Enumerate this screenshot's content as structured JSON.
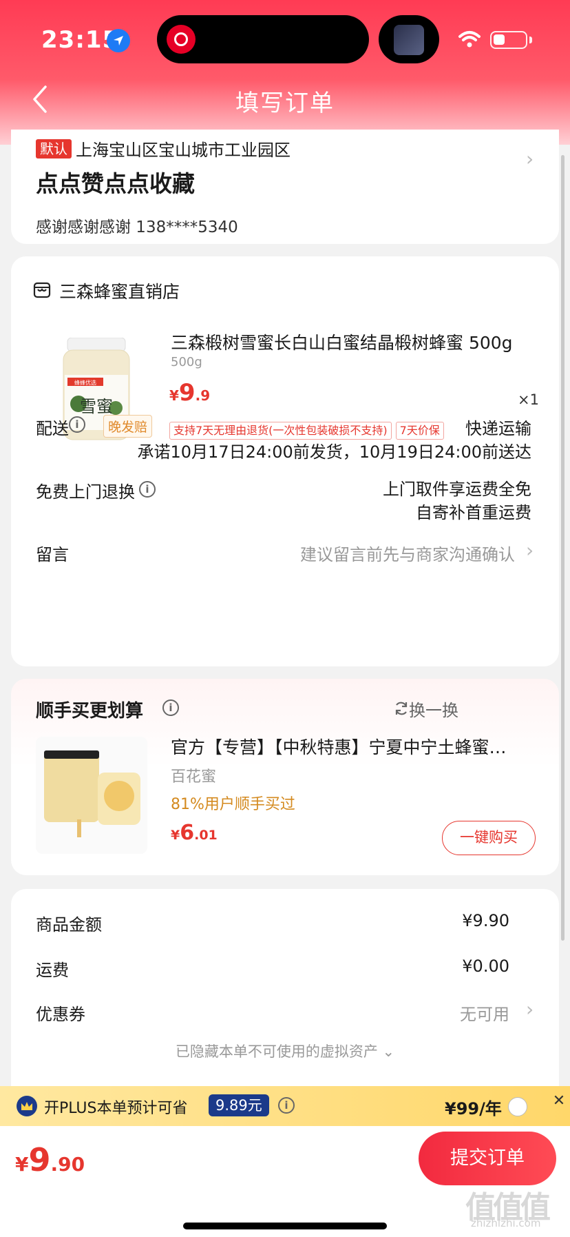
{
  "status_bar": {
    "time": "23:15"
  },
  "nav": {
    "title": "填写订单"
  },
  "address": {
    "default_tag": "默认",
    "line": "上海宝山区宝山城市工业园区",
    "name": "点点赞点点收藏",
    "contact": "感谢感谢感谢  138****5340"
  },
  "shop": {
    "name": "三森蜂蜜直销店",
    "product": {
      "title": "三森椴树雪蜜长白山白蜜结晶椴树蜂蜜 500g",
      "spec": "500g",
      "price_currency": "¥",
      "price_int": "9",
      "price_dec": ".9",
      "qty": "×1",
      "badges": [
        "支持7天无理由退货(一次性包装破损不支持)",
        "7天价保"
      ],
      "image_label": "雪蜜",
      "image_brand": "蜂蜂优选"
    },
    "delivery": {
      "label": "配送",
      "late_tag": "晚发赔",
      "method": "快递运输",
      "promise": "承诺10月17日24:00前发货，10月19日24:00前送达"
    },
    "return": {
      "label": "免费上门退换",
      "line1": "上门取件享运费全免",
      "line2": "自寄补首重运费"
    },
    "message": {
      "label": "留言",
      "placeholder": "建议留言前先与商家沟通确认"
    }
  },
  "recommend": {
    "title": "顺手买更划算",
    "refresh": "换一换",
    "item": {
      "title": "官方【专营】【中秋特惠】宁夏中宁土蜂蜜…",
      "sub": "百花蜜",
      "stat": "81%用户顺手买过",
      "price_currency": "¥",
      "price_int": "6",
      "price_dec": ".01",
      "buy": "一键购买"
    }
  },
  "summary": {
    "goods_label": "商品金额",
    "goods_value": "¥9.90",
    "shipping_label": "运费",
    "shipping_value": "¥0.00",
    "coupon_label": "优惠券",
    "coupon_value": "无可用",
    "hidden_assets": "已隐藏本单不可使用的虚拟资产"
  },
  "plus": {
    "text": "开PLUS本单预计可省",
    "save": "9.89元",
    "price": "¥99/年"
  },
  "bottom": {
    "total_currency": "¥",
    "total_int": "9",
    "total_dec": ".90",
    "submit": "提交订单",
    "watermark": "值值值",
    "watermark_sub": "zhizhizhi.com"
  },
  "colors": {
    "accent": "#e6362e",
    "header": "#ff3b54",
    "plus_blue": "#1b3a8a"
  }
}
